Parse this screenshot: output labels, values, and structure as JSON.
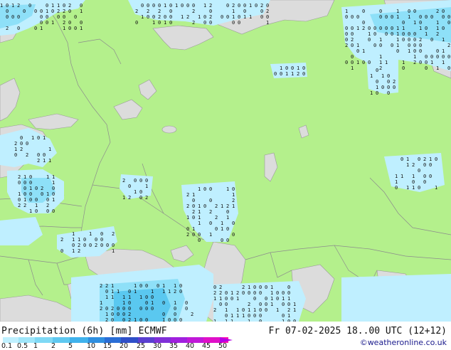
{
  "title": "Precipitation (6h) [mm] ECMWF",
  "valid_time": "Fr 07-02-2025 18..00 UTC (12+12)",
  "credit": "©weatheronline.co.uk",
  "legend": {
    "labels": [
      "0.1",
      "0.5",
      "1",
      "2",
      "5",
      "10",
      "15",
      "20",
      "25",
      "30",
      "35",
      "40",
      "45",
      "50"
    ],
    "colors": [
      "#bff0ff",
      "#9fe6fa",
      "#7fd9f5",
      "#5fc8f0",
      "#40b2ec",
      "#2f8fe0",
      "#2a6ed6",
      "#2f4fc8",
      "#5a3fd0",
      "#8030d8",
      "#a020de",
      "#c018d8",
      "#e010c8",
      "#ff10b0"
    ]
  },
  "colors": {
    "land": "#b4f08c",
    "sea": "#dcdcdc",
    "border": "#8c8c8c",
    "precip_light": "#bfefff",
    "precip_moderate": "#8ee0f8",
    "precip_heavy": "#5ac8f0"
  }
}
